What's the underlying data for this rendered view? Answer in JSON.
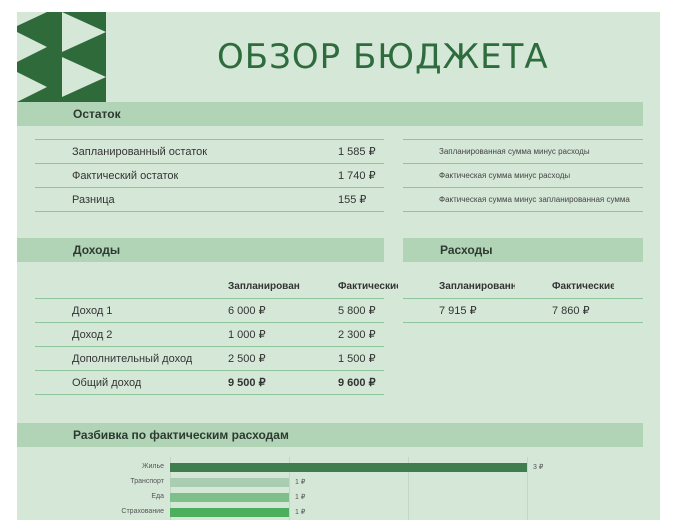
{
  "title": "ОБЗОР БЮДЖЕТА",
  "colors": {
    "accent": "#2e6b3d",
    "band": "#b1d4b6",
    "background": "#d5e8d8"
  },
  "balance": {
    "header": "Остаток",
    "rows": [
      {
        "label": "Запланированный остаток",
        "value": "1 585 ₽",
        "note": "Запланированная сумма минус расходы"
      },
      {
        "label": "Фактический остаток",
        "value": "1 740 ₽",
        "note": "Фактическая сумма минус расходы"
      },
      {
        "label": "Разница",
        "value": "155 ₽",
        "note": "Фактическая сумма минус запланированная сумма"
      }
    ]
  },
  "income": {
    "header": "Доходы",
    "col_planned": "Запланированные",
    "col_actual": "Фактические",
    "rows": [
      {
        "label": "Доход 1",
        "planned": "6 000 ₽",
        "actual": "5 800 ₽"
      },
      {
        "label": "Доход 2",
        "planned": "1 000 ₽",
        "actual": "2 300 ₽"
      },
      {
        "label": "Дополнительный доход",
        "planned": "2 500 ₽",
        "actual": "1 500 ₽"
      },
      {
        "label": "Общий доход",
        "planned": "9 500 ₽",
        "actual": "9 600 ₽"
      }
    ]
  },
  "expenses": {
    "header": "Расходы",
    "col_planned": "Запланированные",
    "col_actual": "Фактические",
    "planned": "7 915 ₽",
    "actual": "7 860 ₽"
  },
  "breakdown": {
    "header": "Разбивка по фактическим расходам"
  },
  "chart_data": {
    "type": "bar",
    "orientation": "horizontal",
    "categories": [
      "Жилье",
      "Транспорт",
      "Еда",
      "Страхование"
    ],
    "values": [
      3,
      1,
      1,
      1
    ],
    "data_labels": [
      "3 ₽",
      "1 ₽",
      "1 ₽",
      "1 ₽"
    ],
    "colors": [
      "#3f7d4e",
      "#a9cdb0",
      "#7fbf8a",
      "#4caf5d"
    ],
    "xlim": [
      0,
      3.5
    ],
    "grid": true
  }
}
